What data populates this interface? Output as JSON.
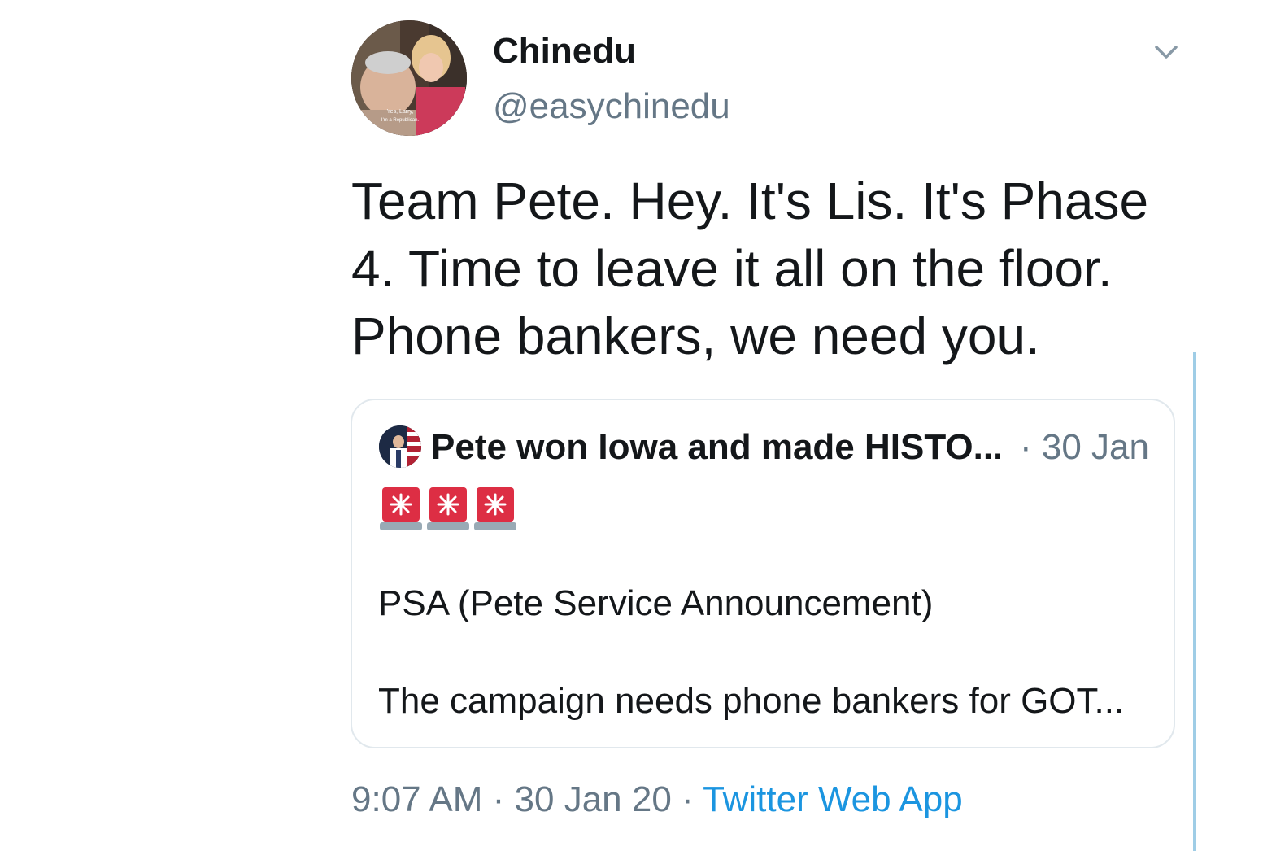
{
  "author": {
    "display_name": "Chinedu",
    "handle": "@easychinedu",
    "avatar_caption_line1": "Yes, Larry,",
    "avatar_caption_line2": "I'm a Republican."
  },
  "tweet": {
    "text": "Team Pete. Hey. It's Lis. It's Phase 4. Time to leave it all on the floor. Phone bankers, we need you."
  },
  "menu": {
    "caret_icon": "chevron-down-icon"
  },
  "quoted_tweet": {
    "author_name": "Pete won Iowa and made HISTO...",
    "date": "· 30 Jan",
    "emoji_icon": "police-light-icon",
    "emoji_count": 3,
    "line1": "PSA (Pete Service Announcement)",
    "line2": "The campaign needs phone bankers for GOT..."
  },
  "meta": {
    "time": "9:07 AM",
    "separator": " · ",
    "date": "30 Jan 20",
    "source": "Twitter Web App"
  },
  "colors": {
    "text_primary": "#14171a",
    "text_secondary": "#657786",
    "link": "#1b95e0",
    "border": "#e1e8ed",
    "thread_line": "#9fcde6",
    "siren_red": "#dd2e44"
  }
}
